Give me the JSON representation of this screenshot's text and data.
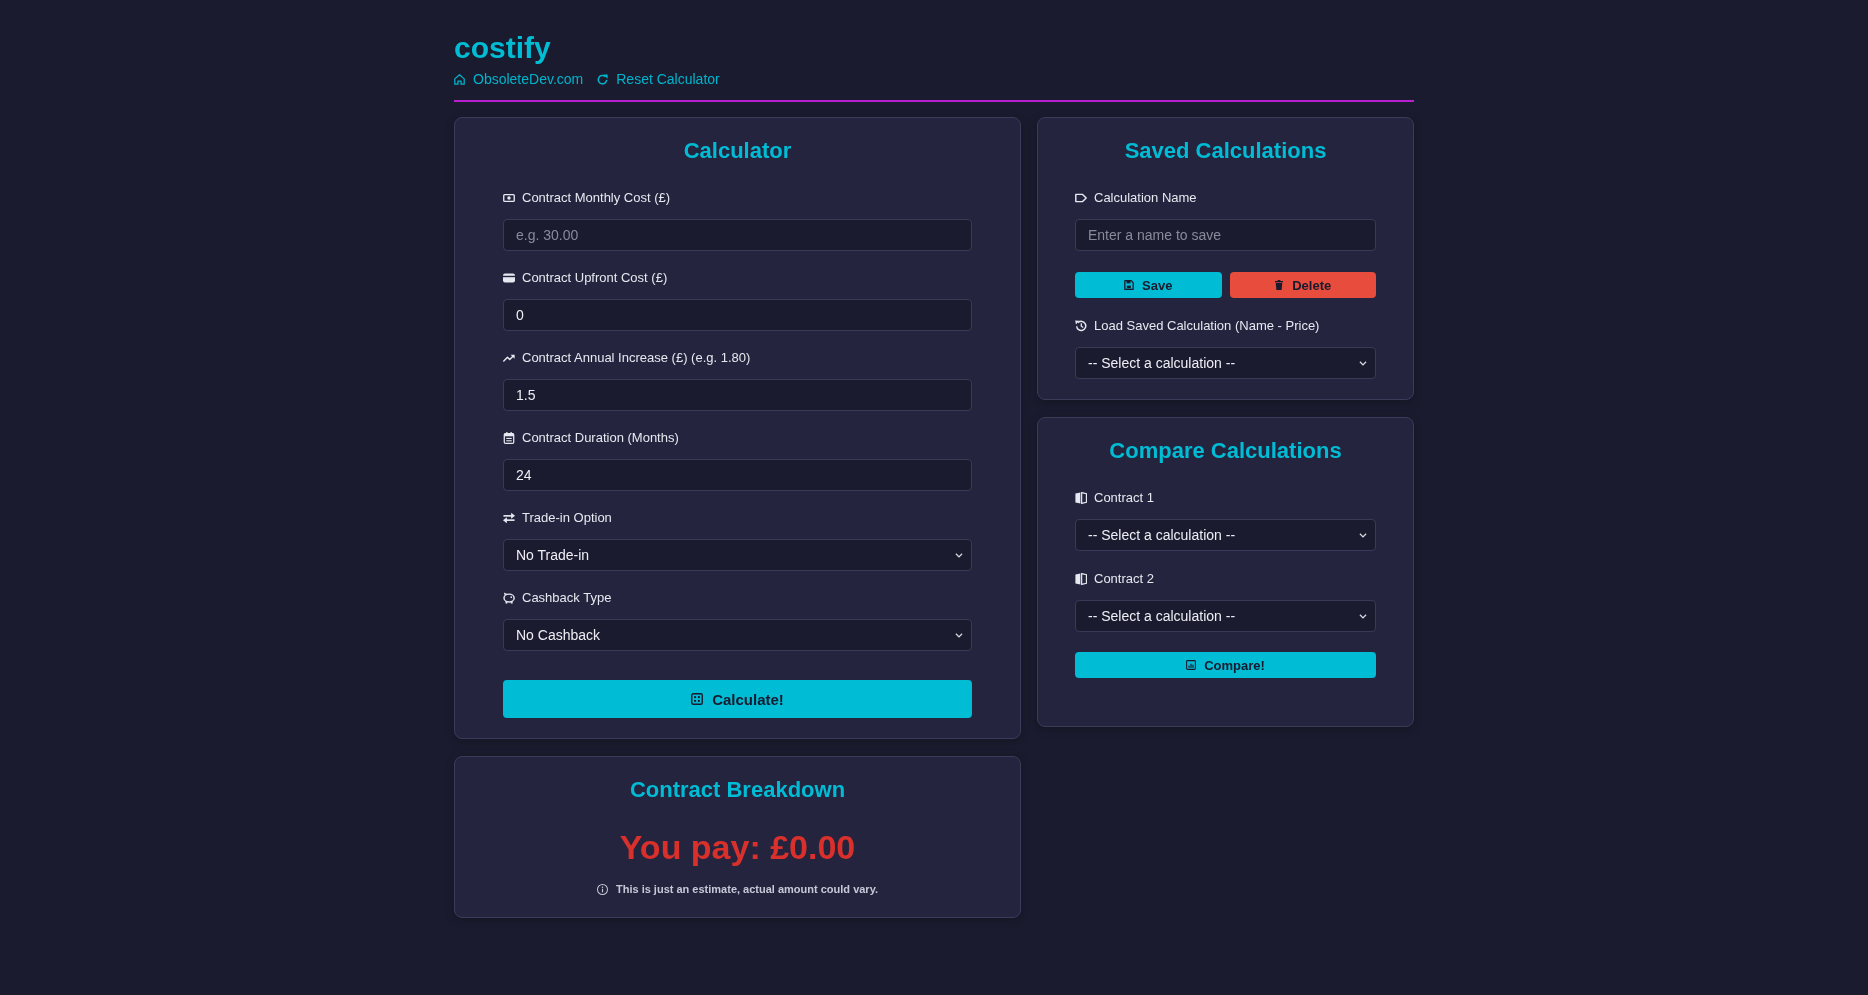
{
  "header": {
    "title": "costify",
    "links": [
      "ObsoleteDev.com",
      "Reset Calculator"
    ]
  },
  "calculator": {
    "title": "Calculator",
    "fields": [
      {
        "kind": "input",
        "label": "Contract Monthly Cost (£)",
        "placeholder": "e.g. 30.00"
      },
      {
        "kind": "input",
        "label": "Contract Upfront Cost (£)",
        "value": "0"
      },
      {
        "kind": "input",
        "label": "Contract Annual Increase (£) (e.g. 1.80)",
        "value": "1.5"
      },
      {
        "kind": "input",
        "label": "Contract Duration (Months)",
        "value": "24"
      },
      {
        "kind": "select",
        "label": "Trade-in Option",
        "value": "No Trade-in"
      },
      {
        "kind": "select",
        "label": "Cashback Type",
        "value": "No Cashback"
      }
    ],
    "button": "Calculate!"
  },
  "breakdown": {
    "title": "Contract Breakdown",
    "total": "You pay: £0.00",
    "note": "This is just an estimate, actual amount could vary."
  },
  "saved": {
    "title": "Saved Calculations",
    "name_field": {
      "label": "Calculation Name",
      "placeholder": "Enter a name to save"
    },
    "buttons": [
      {
        "kind": "primary",
        "label": "Save"
      },
      {
        "kind": "danger",
        "label": "Delete"
      }
    ],
    "load_field": {
      "label": "Load Saved Calculation (Name - Price)",
      "value": "-- Select a calculation --"
    }
  },
  "compare": {
    "title": "Compare Calculations",
    "fields": [
      {
        "label": "Contract 1",
        "value": "-- Select a calculation --"
      },
      {
        "label": "Contract 2",
        "value": "-- Select a calculation --"
      }
    ],
    "button": "Compare!"
  }
}
